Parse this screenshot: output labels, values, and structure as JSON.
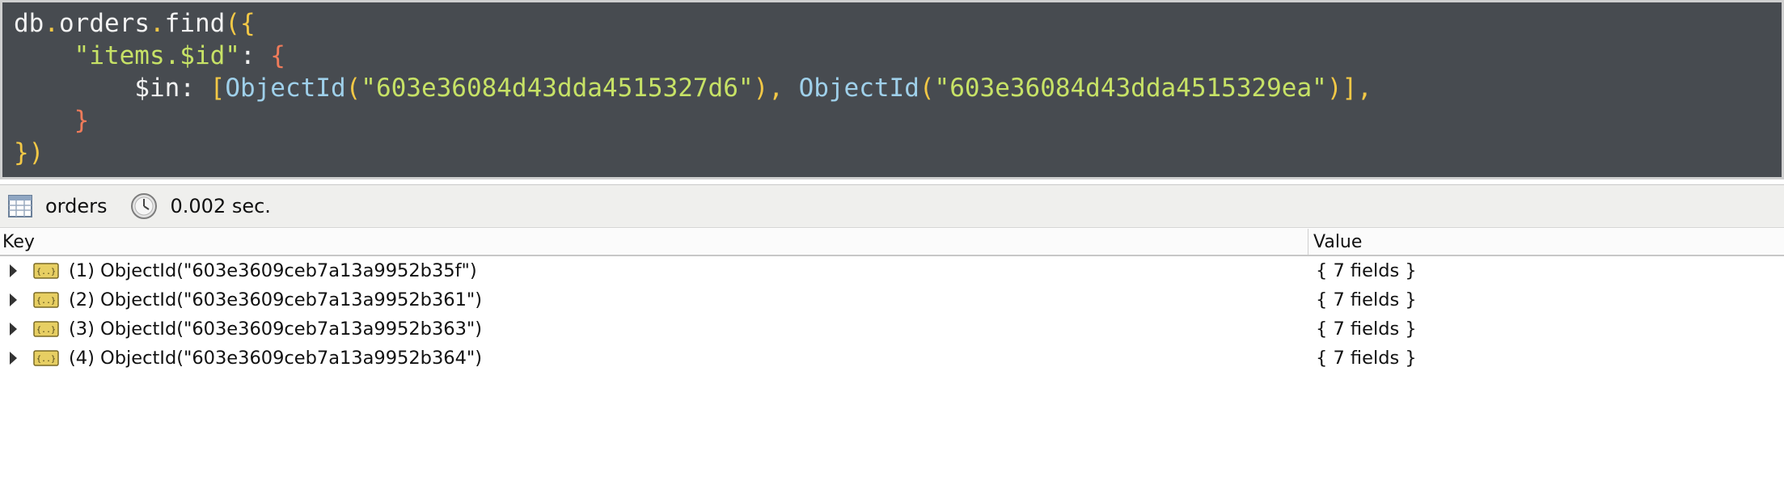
{
  "editor": {
    "lines": [
      [
        "db",
        ".",
        "orders",
        ".",
        "find",
        "({"
      ],
      [
        "    ",
        "\"items.$id\"",
        ": ",
        "{"
      ],
      [
        "        ",
        "$in",
        ": ",
        "[",
        "ObjectId",
        "(",
        "\"603e36084d43dda4515327d6\"",
        "), ",
        "ObjectId",
        "(",
        "\"603e36084d43dda4515329ea\"",
        ")],"
      ],
      [
        "    ",
        "}"
      ],
      [
        "})"
      ]
    ]
  },
  "status": {
    "collection": "orders",
    "time": "0.002 sec."
  },
  "table": {
    "headers": {
      "key": "Key",
      "value": "Value"
    },
    "rows": [
      {
        "key": "(1) ObjectId(\"603e3609ceb7a13a9952b35f\")",
        "value": "{ 7 fields }"
      },
      {
        "key": "(2) ObjectId(\"603e3609ceb7a13a9952b361\")",
        "value": "{ 7 fields }"
      },
      {
        "key": "(3) ObjectId(\"603e3609ceb7a13a9952b363\")",
        "value": "{ 7 fields }"
      },
      {
        "key": "(4) ObjectId(\"603e3609ceb7a13a9952b364\")",
        "value": "{ 7 fields }"
      }
    ]
  },
  "icons": {
    "table": "collection-table-icon",
    "clock": "clock-icon",
    "document": "document-icon",
    "expand": "expand-arrow-icon"
  },
  "colors": {
    "editor_bg": "#474b50",
    "punctuation": "#f3c846",
    "string": "#c7e266",
    "brace": "#ef7b5a",
    "function": "#9fd0ea"
  }
}
